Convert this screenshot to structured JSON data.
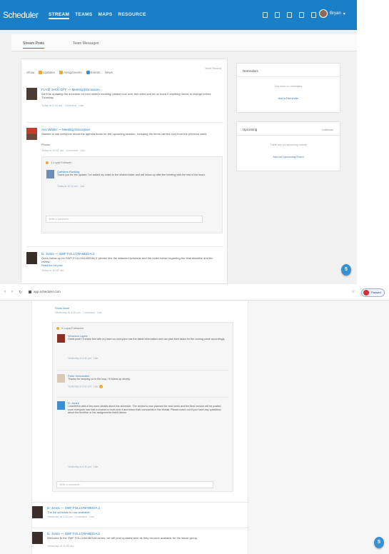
{
  "app": {
    "brand": "Scheduler",
    "nav": [
      "STREAM",
      "TEAMS",
      "MAPS",
      "RESOURCE"
    ],
    "active_nav": "STREAM",
    "user_name": "Bryan",
    "accent": "#1a7fc6"
  },
  "tabs": [
    "Stream Posts",
    "Team Messages"
  ],
  "filters": {
    "show_label": "Show",
    "options": [
      "Updates",
      "Assignments",
      "Events",
      "News"
    ],
    "sort_label": "Most Recent"
  },
  "posts": [
    {
      "title": "FLY D JACK-OFF — Meeting Discussion",
      "text": "We'll be updating the schedule for next week's meeting; please look over the notes and let us know if anything needs to change before Thursday.",
      "meta": "Today at 9:40 am · Comment · Like"
    },
    {
      "title": "Ann Wilder — Meeting Discussion",
      "text": "Wanted to ask everyone about the agenda items for the upcoming session, including the items carried over from the previous week.",
      "label": "Photos",
      "meta": "Today at 10:02 am · Comment · Like",
      "comments_header": "1 Loyal Follower",
      "comment": {
        "name": "Cathleen Rowling",
        "text": "Thank you for the update; I've added my notes to the shared folder and will follow up after the meeting with the rest of the team.",
        "meta": "Today at 10:14 am · Like"
      },
      "comment_placeholder": "Write a comment..."
    },
    {
      "title": "D. Jones — SWF FOLLOW-MEDIA 3",
      "text": "Quick follow up for SWF FOLLOW-MEDIA 3: please see the attached schedule and the notes below regarding the final deadline and the review.",
      "link": "Read the full post",
      "meta": "Today at 10:30 am"
    }
  ],
  "sidebar": {
    "reminders": {
      "title": "Reminders",
      "empty": "You have no reminders",
      "action": "Add a Reminder"
    },
    "upcoming": {
      "title": "Upcoming",
      "link": "Calendar",
      "empty": "There are no upcoming events",
      "action": "Add an Upcoming Event"
    }
  },
  "fab_label": "5",
  "browser": {
    "url": "app.scheduler.com",
    "profile_label": "Paused"
  },
  "thread": {
    "show_more": "Show More",
    "meta": "Yesterday at 4:15 pm · Comment · Like",
    "comments_header": "3 Loyal Followers",
    "comments": [
      {
        "name": "Veronica Lopez",
        "text": "Great post! I'll share this with my team so everyone has the latest information and can plan their tasks for the coming week accordingly.",
        "meta": "Yesterday at 4:40 pm · Like"
      },
      {
        "name": "Peter Hernandez",
        "text": "Thanks for keeping us in the loop, I'll follow up shortly.",
        "meta": "Yesterday at 5:02 pm · Like"
      },
      {
        "name": "D. Jones",
        "text": "I wanted to add a few more details about the schedule. The review is now planned for next week and the final version will be posted once everyone has had a chance to look over it and leave their comments in the thread. Please reach out if you have any questions about the timeline or the assignments listed above.",
        "meta": "Yesterday at 5:30 pm · Like"
      }
    ],
    "comment_placeholder": "Write a comment..."
  },
  "bottom_posts": [
    {
      "title": "D. Jones — SWF FOLLOW-MEDIA 2",
      "text": "The full schedule is now available.",
      "meta": "Yesterday at 2:10 pm · Comment · Like"
    },
    {
      "title": "D. Jones — SWF FOLLOW-MEDIA 1",
      "text": "Welcome to the SWF FOLLOW-MEDIA series; we will post updates here as they become available for the whole group.",
      "meta": "Yesterday at 11:00 am"
    }
  ]
}
